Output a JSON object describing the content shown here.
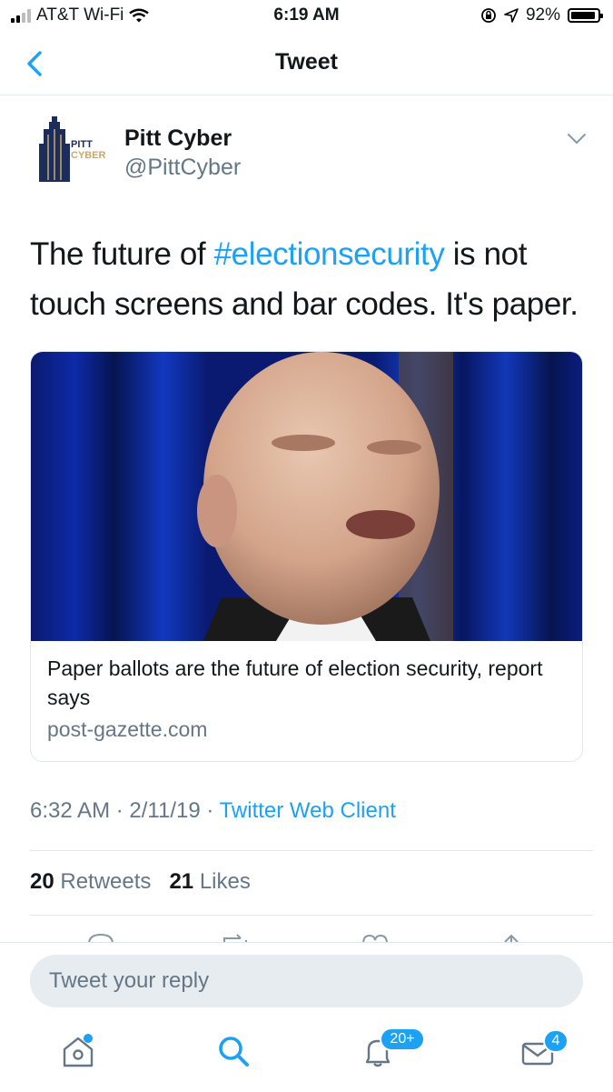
{
  "status_bar": {
    "carrier": "AT&T Wi-Fi",
    "time": "6:19 AM",
    "battery": "92%"
  },
  "nav": {
    "title": "Tweet"
  },
  "tweet": {
    "display_name": "Pitt Cyber",
    "handle": "@PittCyber",
    "logo_text_line1": "PITT",
    "logo_text_line2": "CYBER",
    "text_before": "The future of ",
    "hashtag": "#electionsecurity",
    "text_after": " is not touch screens and bar codes. It's paper.",
    "card": {
      "title": "Paper ballots are the future of election security, report says",
      "domain": "post-gazette.com"
    },
    "timestamp": "6:32 AM · 2/11/19 · ",
    "client": "Twitter Web Client",
    "retweets_count": "20",
    "retweets_label": "Retweets",
    "likes_count": "21",
    "likes_label": "Likes"
  },
  "reply": {
    "placeholder": "Tweet your reply"
  },
  "tab_bar": {
    "notifications_badge": "20+",
    "messages_badge": "4"
  },
  "colors": {
    "accent": "#1da1f2",
    "secondary_text": "#657786",
    "divider": "#e1e8ed"
  }
}
